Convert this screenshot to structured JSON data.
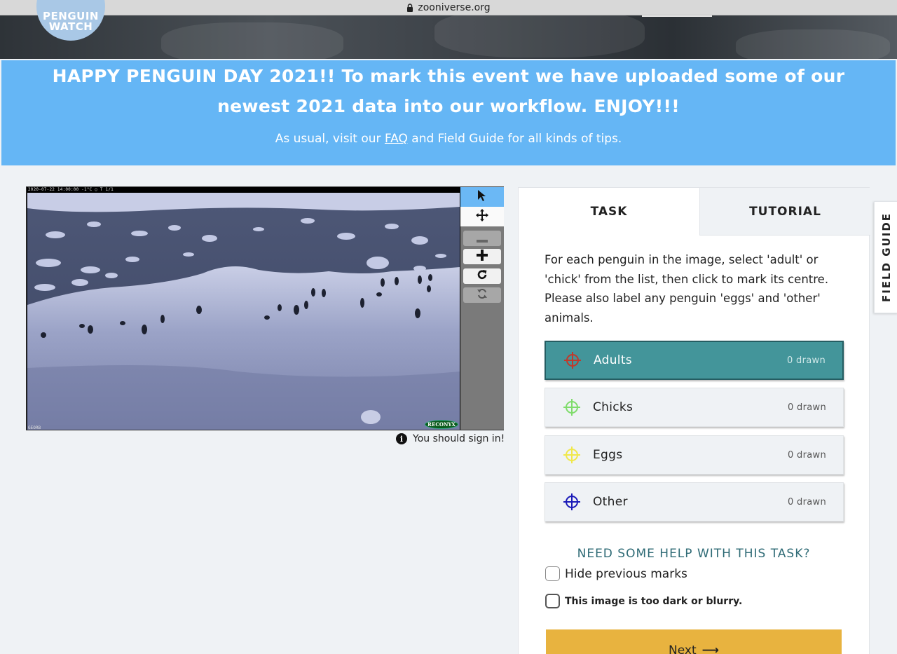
{
  "browser": {
    "url": "zooniverse.org"
  },
  "header": {
    "logo_line1": "PENGUIN",
    "logo_line2": "WATCH"
  },
  "banner": {
    "headline": "HAPPY PENGUIN DAY 2021!! To mark this event we have uploaded some of our newest 2021 data into our workflow. ENJOY!!!",
    "sub_before": "As usual, visit our ",
    "faq_link": "FAQ",
    "sub_after": " and Field Guide for all kinds of tips.",
    "color": "#65b6f5"
  },
  "viewer": {
    "camera_top_text": "2020-07-22 14:00:00      -1°C  ○      T 1/1",
    "camera_bottom_text": "GEORB",
    "camera_brand": "RECONYX",
    "tools": [
      "pointer-icon",
      "move-icon",
      "zoom-out-icon",
      "zoom-in-icon",
      "rotate-icon",
      "reset-icon"
    ],
    "signin_text": "You should sign in!"
  },
  "task_panel": {
    "tabs": [
      {
        "label": "TASK",
        "active": true
      },
      {
        "label": "TUTORIAL",
        "active": false
      }
    ],
    "instructions": "For each penguin in the image, select 'adult' or 'chick' from the list, then click to mark its centre. Please also label any penguin 'eggs' and 'other' animals.",
    "choices": [
      {
        "label": "Adults",
        "count": "0 drawn",
        "color": "#c0392b",
        "selected": true
      },
      {
        "label": "Chicks",
        "count": "0 drawn",
        "color": "#7fdc6b",
        "selected": false
      },
      {
        "label": "Eggs",
        "count": "0 drawn",
        "color": "#f0e84a",
        "selected": false
      },
      {
        "label": "Other",
        "count": "0 drawn",
        "color": "#1a1ab8",
        "selected": false
      }
    ],
    "help_link": "NEED SOME HELP WITH THIS TASK?",
    "hide_marks_label": "Hide previous marks",
    "too_dark_label": "This image is too dark or blurry.",
    "next_label": "Next",
    "next_arrow": "⟶",
    "accent_selected": "#43959a",
    "next_color": "#e8b33f"
  },
  "field_guide": {
    "label": "FIELD GUIDE"
  }
}
